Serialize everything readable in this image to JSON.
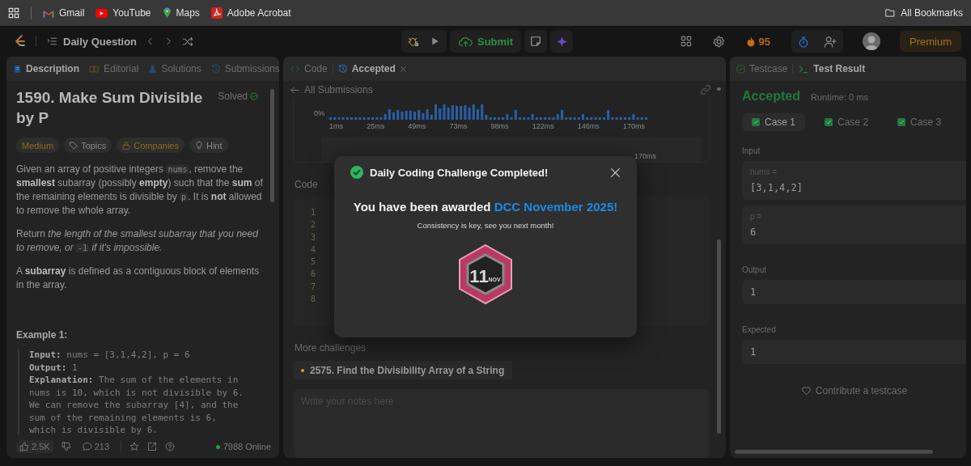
{
  "bookmarks_bar": {
    "items": [
      {
        "label": "Gmail",
        "kind": "gmail"
      },
      {
        "label": "YouTube",
        "kind": "youtube"
      },
      {
        "label": "Maps",
        "kind": "maps"
      },
      {
        "label": "Adobe Acrobat",
        "kind": "acrobat"
      }
    ],
    "all_bookmarks": "All Bookmarks"
  },
  "nav": {
    "title": "Daily Question",
    "submit": "Submit",
    "streak": "95",
    "premium": "Premium"
  },
  "problem_panel": {
    "tabs": [
      {
        "label": "Description",
        "kind": "description",
        "selected": true
      },
      {
        "label": "Editorial",
        "kind": "editorial",
        "selected": false
      },
      {
        "label": "Solutions",
        "kind": "solutions",
        "selected": false
      },
      {
        "label": "Submissions",
        "kind": "submissions",
        "selected": false
      }
    ],
    "title": "1590. Make Sum Divisible by P",
    "status": "Solved",
    "tags": [
      {
        "label": "Medium",
        "kind": "difficulty"
      },
      {
        "label": "Topics",
        "kind": "topics"
      },
      {
        "label": "Companies",
        "kind": "companies"
      },
      {
        "label": "Hint",
        "kind": "hint"
      }
    ],
    "paragraphs": [
      [
        {
          "kind": "text",
          "text": "Given an array of positive integers "
        },
        {
          "kind": "code",
          "text": "nums"
        },
        {
          "kind": "text",
          "text": ", remove the **smallest** subarray (possibly **empty**) such that the **sum** of the remaining elements is divisible by "
        },
        {
          "kind": "code",
          "text": "p"
        },
        {
          "kind": "text",
          "text": ". It is **not** allowed to remove the whole array."
        }
      ],
      [
        {
          "kind": "text",
          "text": "Return *the length of the smallest subarray that you need to remove, or* "
        },
        {
          "kind": "code",
          "text": "-1"
        },
        {
          "kind": "text",
          "text": " *if it's impossible.*"
        }
      ],
      [
        {
          "kind": "text",
          "text": "A **subarray** is defined as a contiguous block of elements in the array."
        }
      ]
    ],
    "example": {
      "title": "Example 1:",
      "lines": [
        "**Input:** nums = [3,1,4,2], p = 6",
        "**Output:** 1",
        "**Explanation:** The sum of the elements in nums is 10, which is not divisible by 6. We can remove the subarray [4], and the sum of the remaining elements is 6, which is divisible by 6."
      ]
    },
    "footer": {
      "likes": "2.5K",
      "comments": "213",
      "online": "7988 Online"
    }
  },
  "submission_panel": {
    "tabs": [
      {
        "label": "Code",
        "kind": "code",
        "selected": false,
        "closable": false
      },
      {
        "label": "Accepted",
        "kind": "accepted",
        "selected": true,
        "closable": true
      }
    ],
    "back_link": "All Submissions",
    "distribution": {
      "y_label": "0%",
      "x_ticks": [
        "1ms",
        "25ms",
        "49ms",
        "73ms",
        "98ms",
        "122ms",
        "146ms",
        "170ms"
      ],
      "overview_ticks": [
        "170ms"
      ]
    },
    "code_header": "Code",
    "line_numbers": [
      "1",
      "2",
      "3",
      "4",
      "5",
      "6",
      "7",
      "8"
    ],
    "more_challenges": {
      "title": "More challenges",
      "items": [
        {
          "label": "2575. Find the Divisibility Array of a String",
          "color": "#c9a227"
        }
      ]
    },
    "notes": {
      "placeholder": "Write your notes here"
    }
  },
  "result_panel": {
    "tabs": [
      {
        "label": "Testcase",
        "kind": "testcase",
        "selected": false
      },
      {
        "label": "Test Result",
        "kind": "result",
        "selected": true
      }
    ],
    "verdict": "Accepted",
    "runtime": "Runtime: 0 ms",
    "cases": [
      {
        "label": "Case 1",
        "selected": true,
        "passed": true
      },
      {
        "label": "Case 2",
        "selected": false,
        "passed": true
      },
      {
        "label": "Case 3",
        "selected": false,
        "passed": true
      }
    ],
    "input_label": "Input",
    "inputs": [
      {
        "label": "nums =",
        "value": "[3,1,4,2]"
      },
      {
        "label": "p =",
        "value": "6"
      }
    ],
    "output_label": "Output",
    "output": "1",
    "expected_label": "Expected",
    "expected": "1",
    "contribute": "Contribute a testcase"
  },
  "modal": {
    "title": "Daily Coding Challenge Completed!",
    "award_text": "You have been awarded ",
    "award_name": "DCC November 2025!",
    "subtitle": "Consistency is key, see you next month!",
    "badge": {
      "day": "11",
      "month": "NOV"
    }
  }
}
